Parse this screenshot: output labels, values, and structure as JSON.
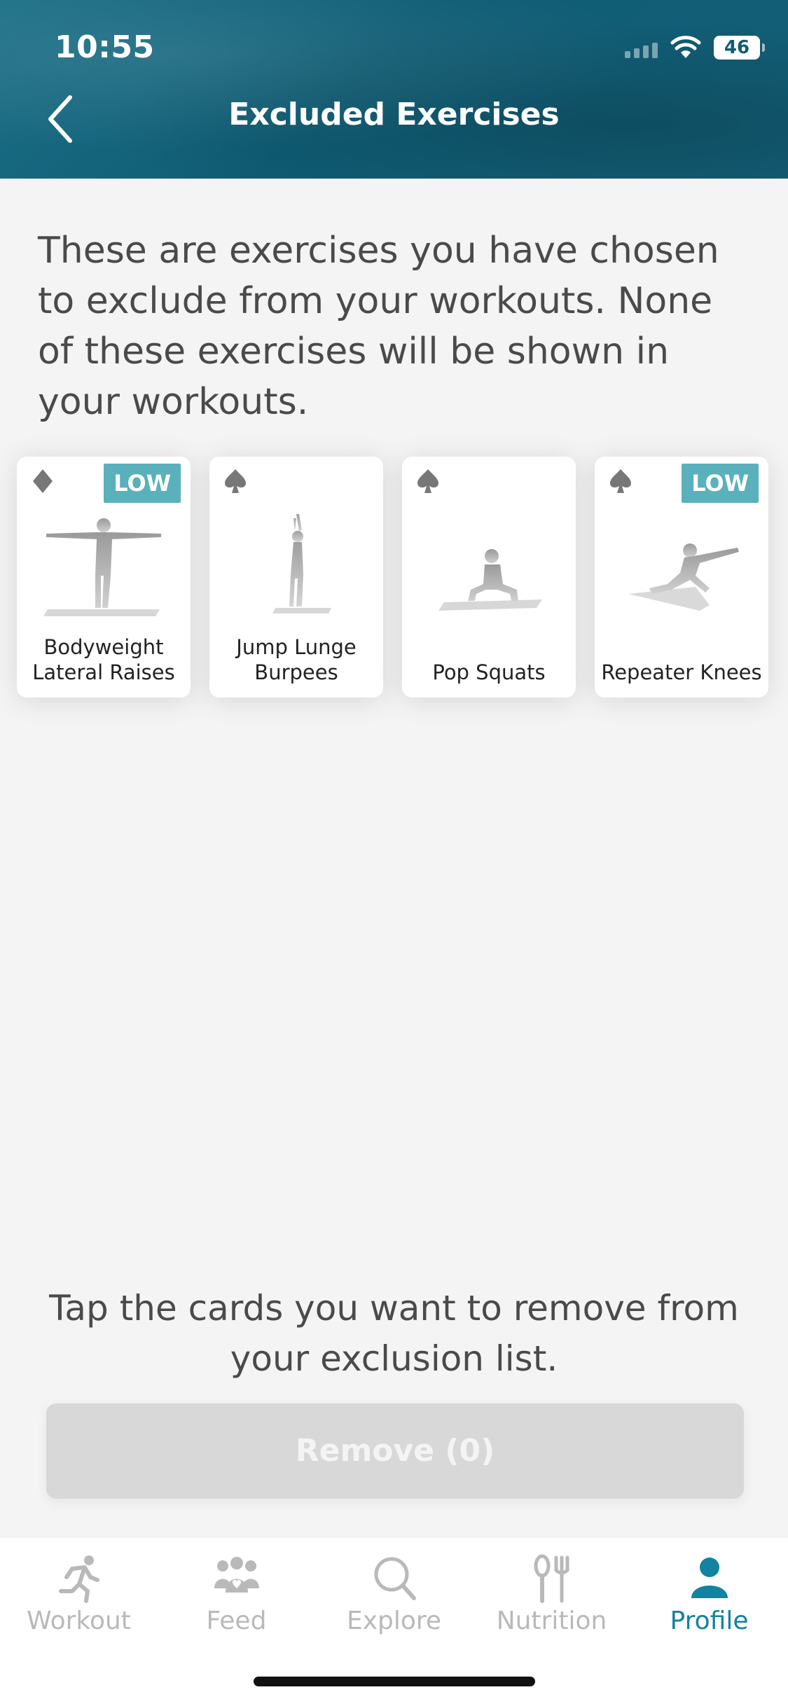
{
  "status": {
    "time": "10:55",
    "battery": "46"
  },
  "header": {
    "title": "Excluded Exercises"
  },
  "description": "These are exercises you have chosen to exclude from your workouts. None of these exercises will be shown in your workouts.",
  "cards": [
    {
      "suit": "diamond",
      "intensity": "LOW",
      "label_line1": "Bodyweight",
      "label_line2": "Lateral Raises"
    },
    {
      "suit": "spade",
      "intensity": "",
      "label_line1": "Jump Lunge",
      "label_line2": "Burpees"
    },
    {
      "suit": "spade",
      "intensity": "",
      "label_line1": "",
      "label_line2": "Pop Squats"
    },
    {
      "suit": "spade",
      "intensity": "LOW",
      "label_line1": "",
      "label_line2": "Repeater Knees"
    }
  ],
  "instructions": "Tap the cards you want to remove from your exclusion list.",
  "remove_button": "Remove (0)",
  "tabs": [
    {
      "label": "Workout",
      "icon": "running-icon",
      "active": false
    },
    {
      "label": "Feed",
      "icon": "group-icon",
      "active": false
    },
    {
      "label": "Explore",
      "icon": "search-icon",
      "active": false
    },
    {
      "label": "Nutrition",
      "icon": "utensils-icon",
      "active": false
    },
    {
      "label": "Profile",
      "icon": "person-icon",
      "active": true
    }
  ],
  "colors": {
    "accent": "#1283a0",
    "header": "#0f5d75",
    "badge": "#5ab0bb",
    "inactive": "#b9b9b9"
  }
}
